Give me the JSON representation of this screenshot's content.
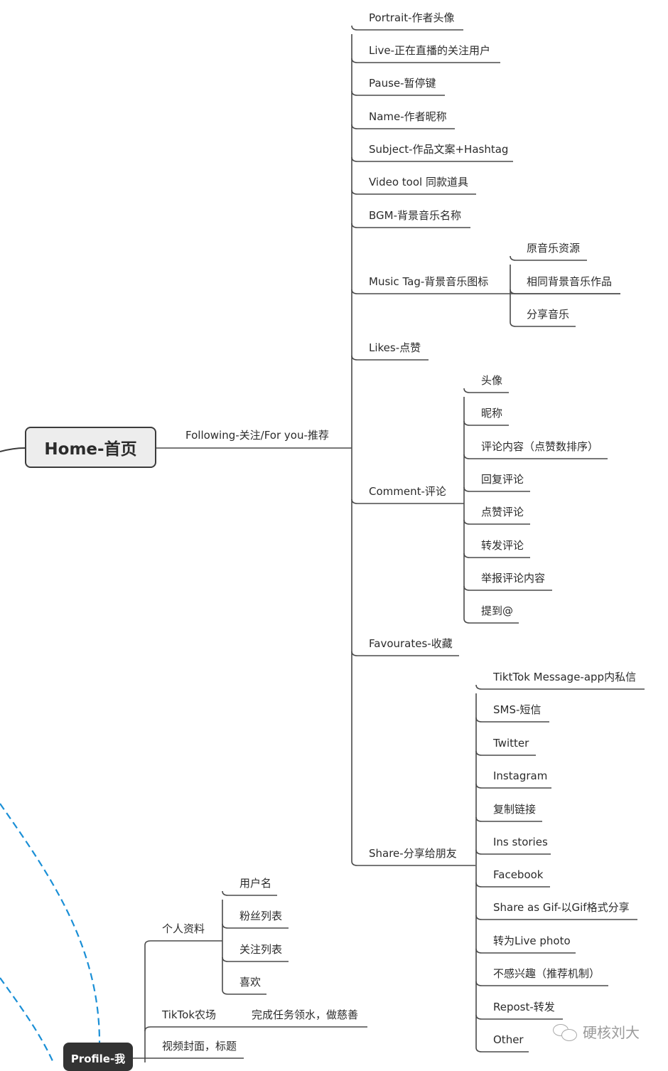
{
  "root": {
    "home": {
      "label": "Home-首页",
      "branch_label": "Following-关注/For you-推荐",
      "children": [
        {
          "label": "Portrait-作者头像"
        },
        {
          "label": "Live-正在直播的关注用户"
        },
        {
          "label": "Pause-暂停键"
        },
        {
          "label": "Name-作者昵称"
        },
        {
          "label": "Subject-作品文案+Hashtag"
        },
        {
          "label": "Video tool 同款道具"
        },
        {
          "label": "BGM-背景音乐名称"
        },
        {
          "label": "Music Tag-背景音乐图标",
          "children": [
            {
              "label": "原音乐资源"
            },
            {
              "label": "相同背景音乐作品"
            },
            {
              "label": "分享音乐"
            }
          ]
        },
        {
          "label": "Likes-点赞"
        },
        {
          "label": "Comment-评论",
          "children": [
            {
              "label": "头像"
            },
            {
              "label": "昵称"
            },
            {
              "label": "评论内容（点赞数排序）"
            },
            {
              "label": "回复评论"
            },
            {
              "label": "点赞评论"
            },
            {
              "label": "转发评论"
            },
            {
              "label": "举报评论内容"
            },
            {
              "label": "提到@"
            }
          ]
        },
        {
          "label": "Favourates-收藏"
        },
        {
          "label": "Share-分享给朋友",
          "children": [
            {
              "label": "TiktTok Message-app内私信"
            },
            {
              "label": "SMS-短信"
            },
            {
              "label": "Twitter"
            },
            {
              "label": "Instagram"
            },
            {
              "label": "复制链接"
            },
            {
              "label": "Ins stories"
            },
            {
              "label": "Facebook"
            },
            {
              "label": "Share as Gif-以Gif格式分享"
            },
            {
              "label": "转为Live photo"
            },
            {
              "label": "不感兴趣（推荐机制）"
            },
            {
              "label": "Repost-转发"
            },
            {
              "label": "Other"
            }
          ]
        }
      ]
    },
    "profile": {
      "label": "Profile-我",
      "children": [
        {
          "label": "个人资料",
          "children": [
            {
              "label": "用户名"
            },
            {
              "label": "粉丝列表"
            },
            {
              "label": "关注列表"
            },
            {
              "label": "喜欢"
            }
          ]
        },
        {
          "label": "TikTok农场",
          "children": [
            {
              "label": "完成任务领水，做慈善"
            }
          ]
        },
        {
          "label": "视频封面，标题"
        }
      ]
    }
  },
  "colors": {
    "line": "#4a4a4a",
    "relation_dashed": "#1a8fd6",
    "home_fill": "#ededed",
    "profile_fill": "#333333"
  },
  "watermark": {
    "icon": "wechat-icon",
    "text": "硬核刘大"
  }
}
